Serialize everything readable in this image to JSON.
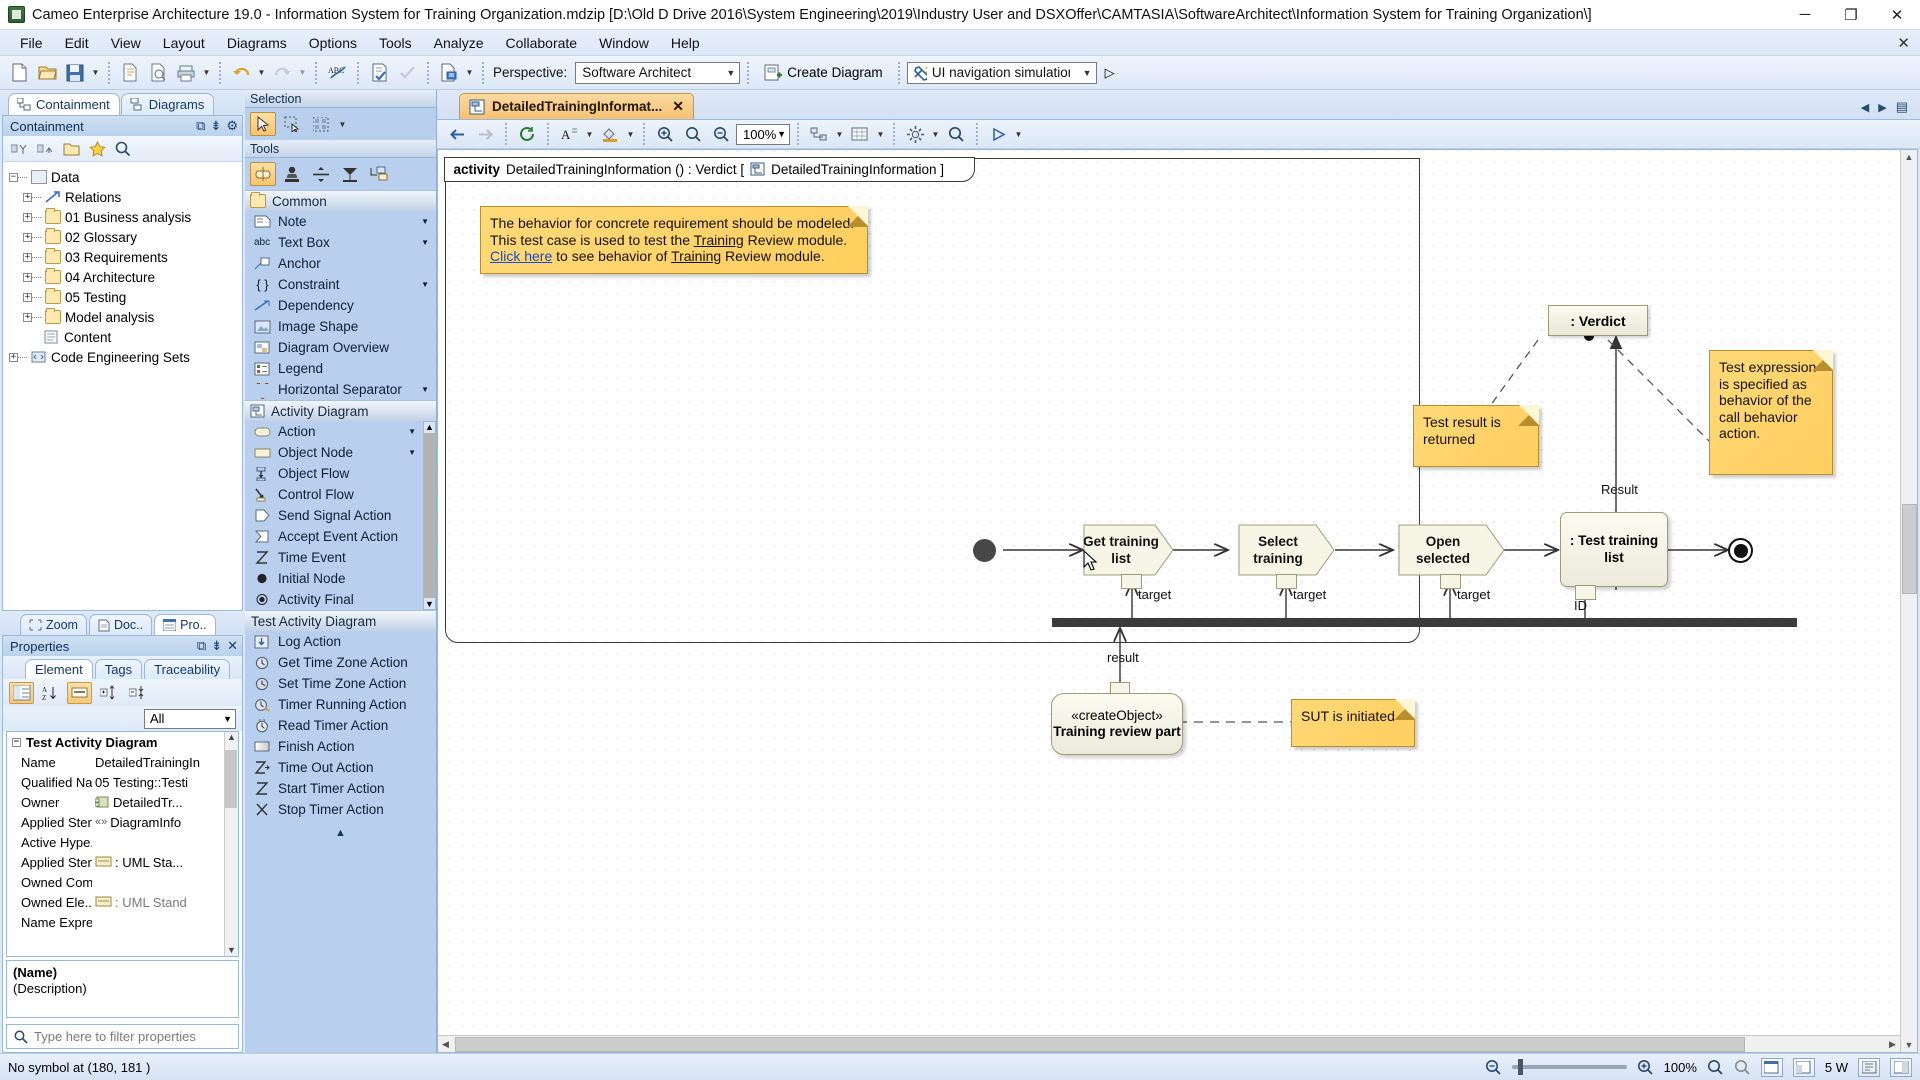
{
  "window": {
    "title": "Cameo Enterprise Architecture 19.0 - Information System for Training Organization.mdzip [D:\\Old D Drive 2016\\System Engineering\\2019\\Industry User and DSXOffer\\CAMTASIA\\SoftwareArchitect\\Information System for Training Organization\\]",
    "minimize": "─",
    "maximize": "❐",
    "close": "✕"
  },
  "menu": {
    "items": [
      "File",
      "Edit",
      "View",
      "Layout",
      "Diagrams",
      "Options",
      "Tools",
      "Analyze",
      "Collaborate",
      "Window",
      "Help"
    ],
    "close_label": "✕"
  },
  "toolbar": {
    "perspective_label": "Perspective:",
    "perspective_value": "Software Architect",
    "create_diagram_label": "Create Diagram",
    "simulation_value": "UI navigation simulation cor",
    "run_label": "▷"
  },
  "left": {
    "tabs": [
      {
        "label": "Containment",
        "active": true
      },
      {
        "label": "Diagrams",
        "active": false
      }
    ],
    "panel_title": "Containment",
    "tree": [
      {
        "label": "Data",
        "depth": 0,
        "expander": "−",
        "icon": "model-icon"
      },
      {
        "label": "Relations",
        "depth": 1,
        "expander": "+",
        "icon": "relations-icon"
      },
      {
        "label": "01 Business analysis",
        "depth": 1,
        "expander": "+",
        "icon": "folder-icon"
      },
      {
        "label": "02 Glossary",
        "depth": 1,
        "expander": "+",
        "icon": "folder-icon"
      },
      {
        "label": "03 Requirements",
        "depth": 1,
        "expander": "+",
        "icon": "folder-icon"
      },
      {
        "label": "04 Architecture",
        "depth": 1,
        "expander": "+",
        "icon": "folder-icon"
      },
      {
        "label": "05 Testing",
        "depth": 1,
        "expander": "+",
        "icon": "folder-icon"
      },
      {
        "label": "Model analysis",
        "depth": 1,
        "expander": "+",
        "icon": "folder-icon"
      },
      {
        "label": "Content",
        "depth": 1,
        "expander": "",
        "icon": "content-icon"
      },
      {
        "label": "Code Engineering Sets",
        "depth": 0,
        "expander": "+",
        "icon": "code-icon"
      }
    ]
  },
  "bottomleft": {
    "tabs": [
      {
        "label": "Zoom",
        "active": false
      },
      {
        "label": "Doc..",
        "active": false
      },
      {
        "label": "Pro..",
        "active": true
      }
    ],
    "panel_title": "Properties",
    "subtabs": [
      {
        "label": "Element",
        "active": true
      },
      {
        "label": "Tags",
        "active": false
      },
      {
        "label": "Traceability",
        "active": false
      }
    ],
    "filter_value": "All",
    "group_label": "Test Activity Diagram",
    "rows": [
      {
        "key": "Name",
        "value": "DetailedTrainingIn",
        "icon": ""
      },
      {
        "key": "Qualified Na...",
        "value": "05 Testing::Testi",
        "icon": ""
      },
      {
        "key": "Owner",
        "value": "DetailedTr...",
        "icon": "component-icon"
      },
      {
        "key": "Applied Ster...",
        "value": "DiagramInfo",
        "icon": "stereotype-icon"
      },
      {
        "key": "Active Hype...",
        "value": "",
        "icon": ""
      },
      {
        "key": "Applied Ster...",
        "value": ": UML Sta...",
        "icon": "slot-icon"
      },
      {
        "key": "Owned Com...",
        "value": "",
        "icon": ""
      },
      {
        "key": "Owned Ele...",
        "value": ": UML Stand",
        "icon": "slot-icon"
      },
      {
        "key": "Name Expre...",
        "value": "",
        "icon": ""
      }
    ],
    "desc_title": "(Name)",
    "desc_text": "(Description)",
    "search_placeholder": "Type here to filter properties"
  },
  "palette": {
    "selection_header": "Selection",
    "tools_header": "Tools",
    "groups": [
      {
        "name": "Common",
        "items": [
          {
            "label": "Note",
            "icon": "note-icon",
            "dropdown": true
          },
          {
            "label": "Text Box",
            "icon": "textbox-icon",
            "dropdown": true
          },
          {
            "label": "Anchor",
            "icon": "anchor-icon",
            "dropdown": false
          },
          {
            "label": "Constraint",
            "icon": "constraint-icon",
            "dropdown": true
          },
          {
            "label": "Dependency",
            "icon": "dependency-icon",
            "dropdown": false
          },
          {
            "label": "Image Shape",
            "icon": "image-shape-icon",
            "dropdown": false
          },
          {
            "label": "Diagram Overview",
            "icon": "diagram-overview-icon",
            "dropdown": false
          },
          {
            "label": "Legend",
            "icon": "legend-icon",
            "dropdown": false
          },
          {
            "label": "Horizontal Separator",
            "icon": "separator-icon",
            "dropdown": true
          }
        ]
      },
      {
        "name": "Activity Diagram",
        "items": [
          {
            "label": "Action",
            "icon": "action-icon",
            "dropdown": true
          },
          {
            "label": "Object Node",
            "icon": "object-node-icon",
            "dropdown": true
          },
          {
            "label": "Object Flow",
            "icon": "object-flow-icon",
            "dropdown": false
          },
          {
            "label": "Control Flow",
            "icon": "control-flow-icon",
            "dropdown": false
          },
          {
            "label": "Send Signal Action",
            "icon": "send-signal-icon",
            "dropdown": false
          },
          {
            "label": "Accept Event Action",
            "icon": "accept-event-icon",
            "dropdown": false
          },
          {
            "label": "Time Event",
            "icon": "time-event-icon",
            "dropdown": false
          },
          {
            "label": "Initial Node",
            "icon": "initial-node-icon",
            "dropdown": false
          },
          {
            "label": "Activity Final",
            "icon": "activity-final-icon",
            "dropdown": false
          }
        ]
      },
      {
        "name": "Test Activity Diagram",
        "items": [
          {
            "label": "Log Action",
            "icon": "log-action-icon",
            "dropdown": false
          },
          {
            "label": "Get Time Zone Action",
            "icon": "get-time-zone-icon",
            "dropdown": false
          },
          {
            "label": "Set Time Zone Action",
            "icon": "set-time-zone-icon",
            "dropdown": false
          },
          {
            "label": "Timer Running Action",
            "icon": "timer-running-icon",
            "dropdown": false
          },
          {
            "label": "Read Timer Action",
            "icon": "read-timer-icon",
            "dropdown": false
          },
          {
            "label": "Finish Action",
            "icon": "finish-action-icon",
            "dropdown": false
          },
          {
            "label": "Time Out Action",
            "icon": "time-out-icon",
            "dropdown": false
          },
          {
            "label": "Start Timer Action",
            "icon": "start-timer-icon",
            "dropdown": false
          },
          {
            "label": "Stop Timer Action",
            "icon": "stop-timer-icon",
            "dropdown": false
          }
        ]
      }
    ],
    "collapse": "▲"
  },
  "diagram": {
    "tab_label": "DetailedTrainingInformat...",
    "tab_close": "✕",
    "zoom_value": "100%",
    "frame_kind": "activity",
    "frame_name": "DetailedTrainingInformation () : Verdict [",
    "frame_ref": "DetailedTrainingInformation  ]",
    "notes": [
      {
        "id": "note-behavior",
        "text_parts": [
          "The behavior for concrete requirement should be modeled. This test case is used to test the ",
          "Training",
          " Review module. ",
          "Click here",
          " to see behavior of ",
          "Training",
          " Review module."
        ]
      },
      {
        "id": "note-test-result",
        "text": "Test result is returned"
      },
      {
        "id": "note-test-expression",
        "text": "Test expression is specified as behavior of the call behavior action."
      },
      {
        "id": "note-sut",
        "text": "SUT is initiated"
      }
    ],
    "actions": [
      {
        "id": "action-get-training-list",
        "label": "Get training  list",
        "pin_label": "target"
      },
      {
        "id": "action-select-training",
        "label": "Select training",
        "pin_label": "target"
      },
      {
        "id": "action-open-selected",
        "label": "Open selected",
        "pin_label": "target"
      },
      {
        "id": "action-test-training-list",
        "label": ": Test training list",
        "pin_label": "ID"
      }
    ],
    "verdict_label": ": Verdict",
    "result_label": "Result",
    "object_node": {
      "stereotype": "«createObject»",
      "name": "Training review part",
      "flow_label": "result"
    }
  },
  "status": {
    "message": "No symbol at (180, 181 )",
    "zoom_value": "100%",
    "indicator": "5 W"
  }
}
